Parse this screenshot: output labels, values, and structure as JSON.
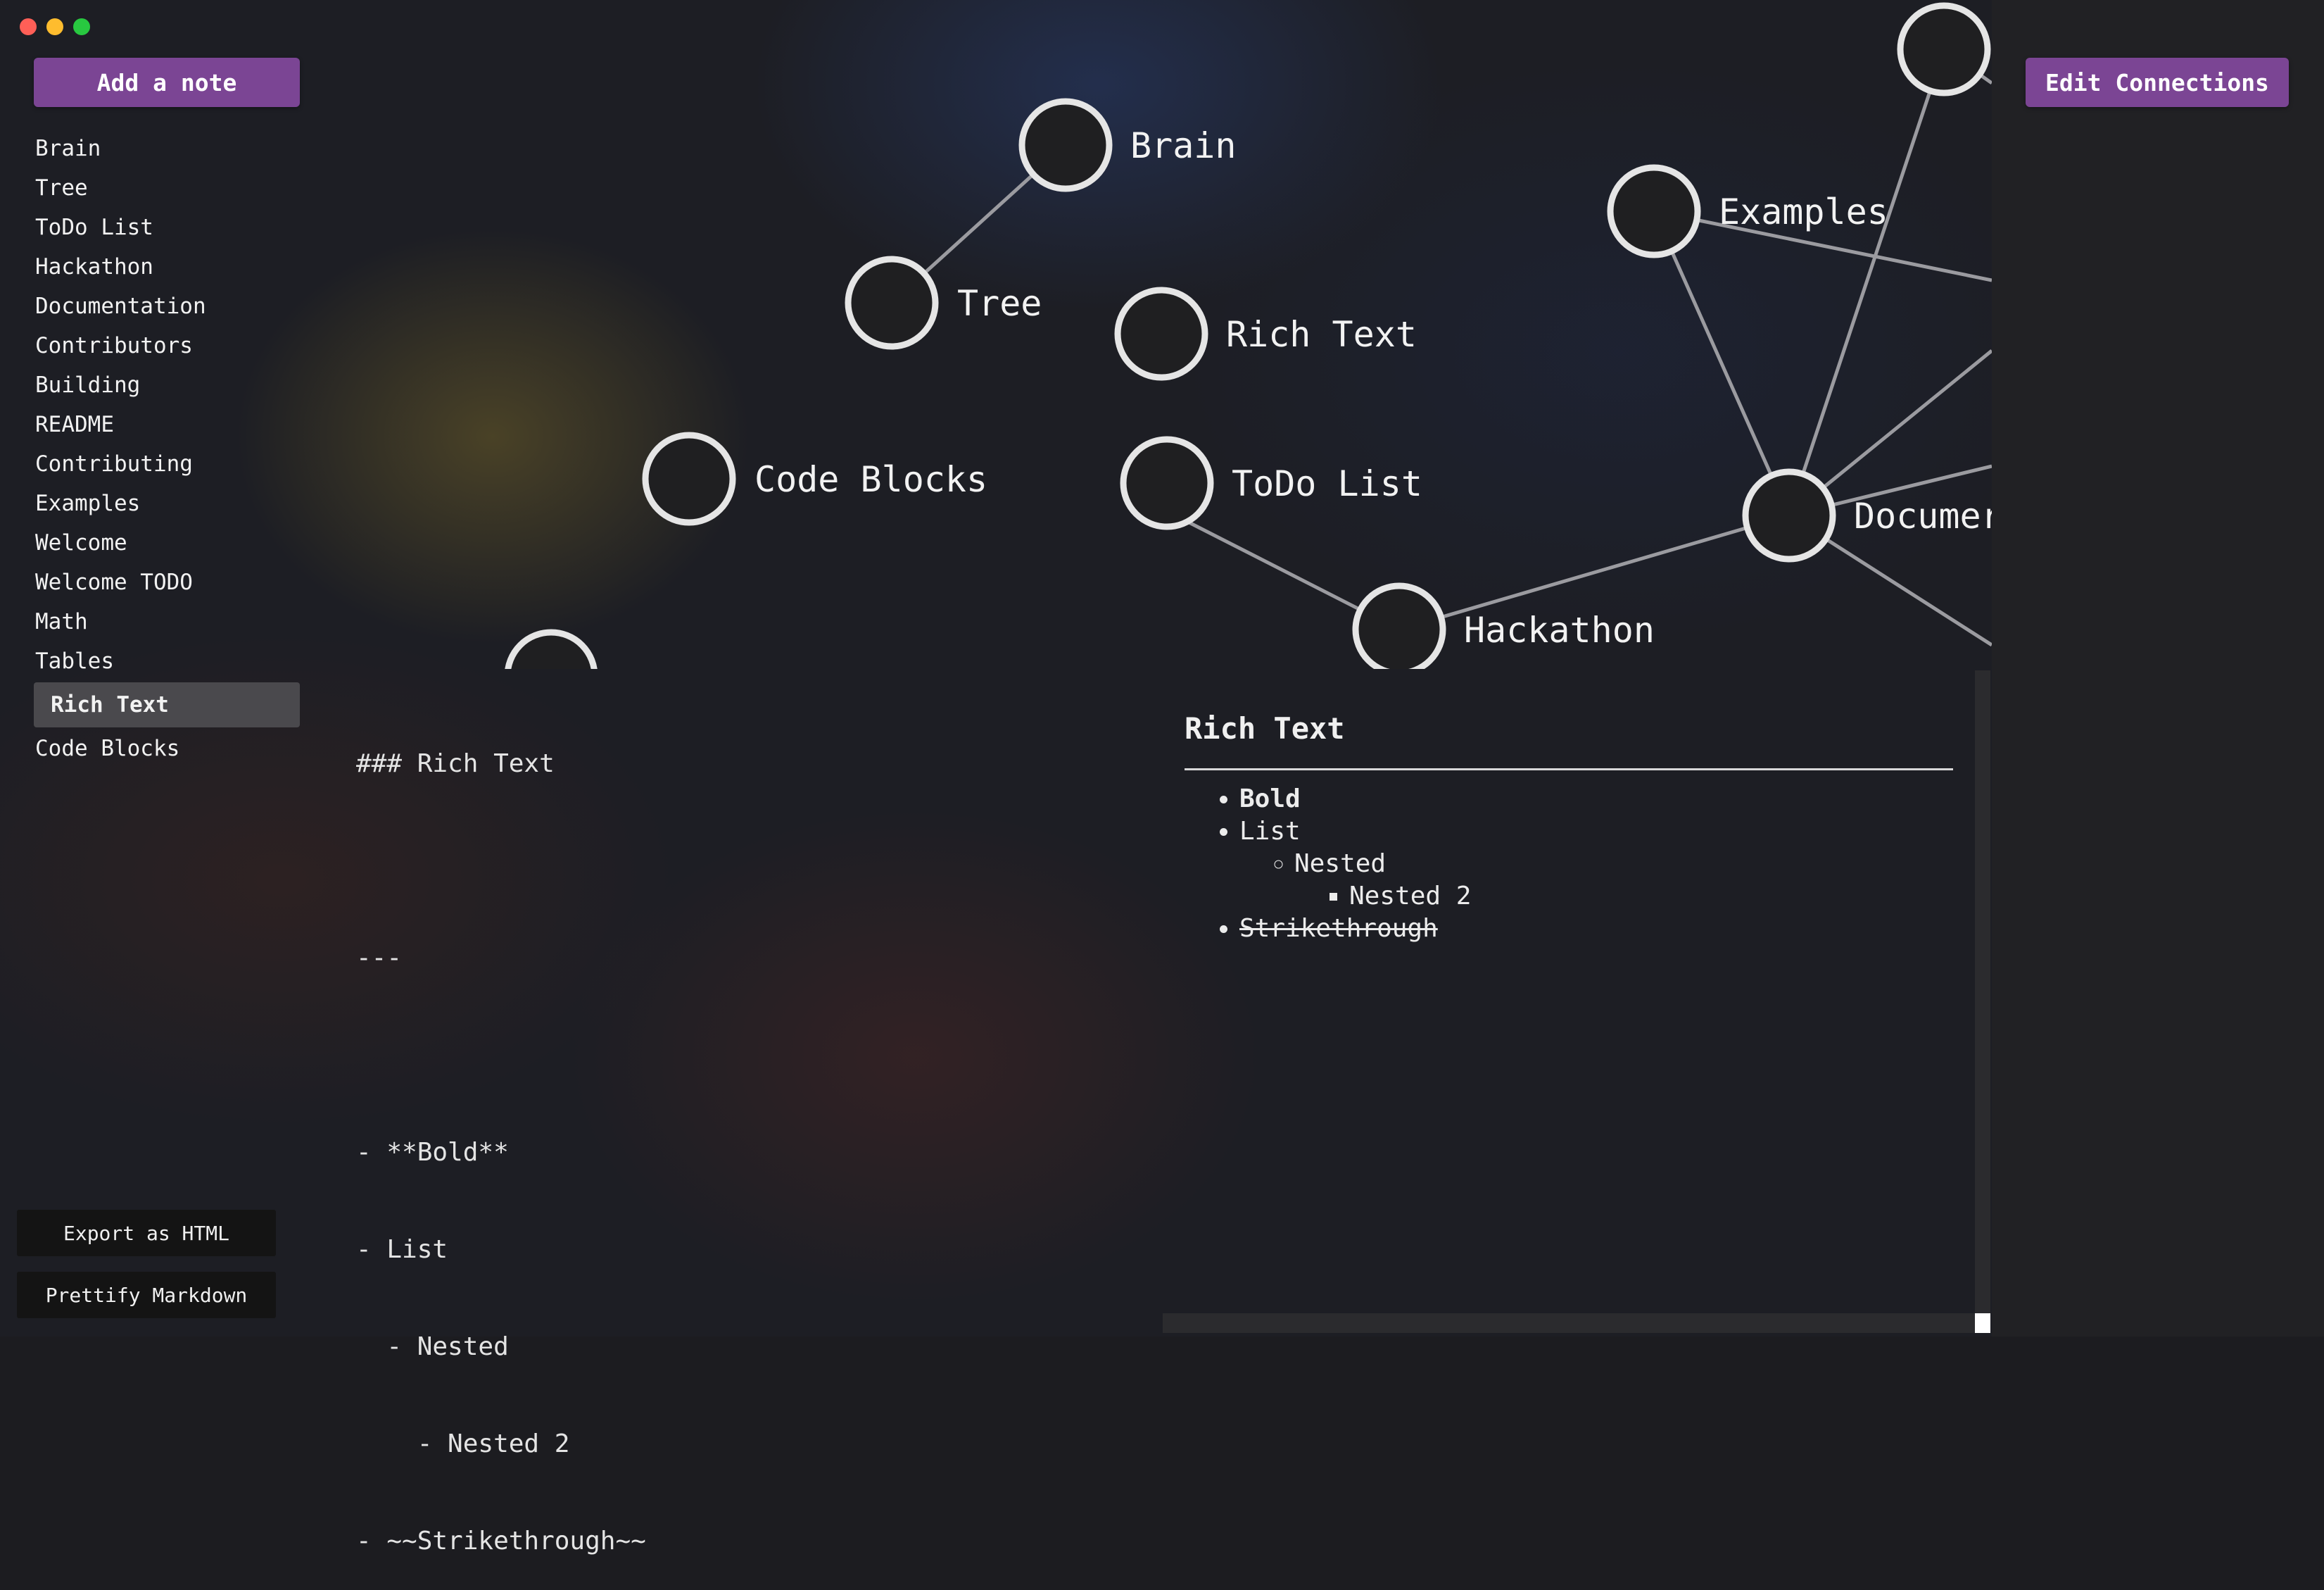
{
  "window": {
    "traffic_lights": {
      "close": "#ff5f57",
      "minimize": "#febc2e",
      "zoom": "#28c840"
    }
  },
  "toolbar": {
    "add_note_label": "Add a note",
    "edit_connections_label": "Edit Connections",
    "accent_color": "#7b4594"
  },
  "sidebar": {
    "items": [
      {
        "label": "Brain"
      },
      {
        "label": "Tree"
      },
      {
        "label": "ToDo List"
      },
      {
        "label": "Hackathon"
      },
      {
        "label": "Documentation"
      },
      {
        "label": "Contributors"
      },
      {
        "label": "Building"
      },
      {
        "label": "README"
      },
      {
        "label": "Contributing"
      },
      {
        "label": "Examples"
      },
      {
        "label": "Welcome"
      },
      {
        "label": "Welcome TODO"
      },
      {
        "label": "Math"
      },
      {
        "label": "Tables"
      },
      {
        "label": "Rich Text",
        "active": true
      },
      {
        "label": "Code Blocks"
      }
    ],
    "export_label": "Export as HTML",
    "prettify_label": "Prettify Markdown"
  },
  "graph": {
    "nodes": [
      {
        "label": "Brain"
      },
      {
        "label": "Tree"
      },
      {
        "label": "Rich Text"
      },
      {
        "label": "Code Blocks"
      },
      {
        "label": "ToDo List"
      },
      {
        "label": "Hackathon"
      },
      {
        "label": "Examples"
      },
      {
        "label": "Documer"
      }
    ]
  },
  "editor": {
    "lines": [
      "### Rich Text",
      "",
      "---",
      "",
      "- **Bold**",
      "- List",
      "  - Nested",
      "    - Nested 2",
      "- ~~Strikethrough~~"
    ]
  },
  "preview": {
    "title": "Rich Text",
    "bold": "Bold",
    "list": "List",
    "nested": "Nested",
    "nested2": "Nested 2",
    "strike": "Strikethrough"
  }
}
